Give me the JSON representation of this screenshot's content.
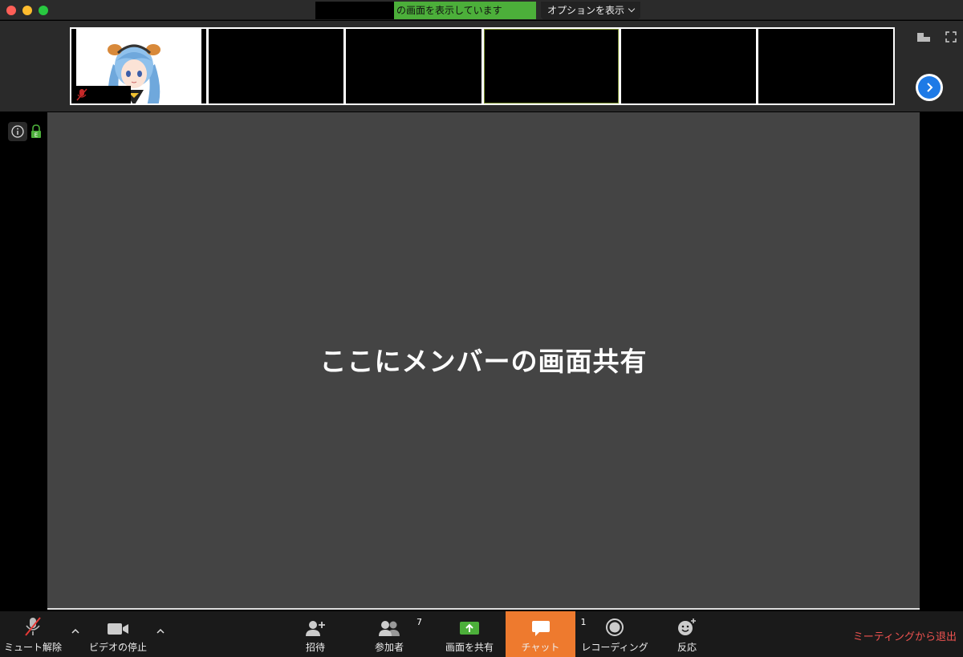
{
  "window": {
    "share_status": "の画面を表示しています",
    "options_label": "オプションを表示",
    "colors": {
      "share_green": "#4caf3a",
      "main_bg": "#444444",
      "chat_orange": "#ee7a2e",
      "end_red": "#ef5350",
      "nav_blue": "#1e7ae6"
    }
  },
  "filmstrip": {
    "thumbnails": [
      {
        "id": "participant-1",
        "muted": true
      },
      {
        "id": "participant-2"
      },
      {
        "id": "participant-3"
      },
      {
        "id": "participant-4",
        "highlighted": true
      },
      {
        "id": "participant-5"
      },
      {
        "id": "participant-6"
      }
    ],
    "icons": [
      "layout-icon",
      "fullscreen-icon",
      "next-page-icon"
    ]
  },
  "main": {
    "share_text": "ここにメンバーの画面共有"
  },
  "toolbar": {
    "unmute_label": "ミュート解除",
    "video_stop_label": "ビデオの停止",
    "invite_label": "招待",
    "participants_label": "参加者",
    "participants_count": "7",
    "share_screen_label": "画面を共有",
    "chat_label": "チャット",
    "chat_count": "1",
    "recording_label": "レコーディング",
    "reactions_label": "反応",
    "end_label": "ミーティングから退出"
  }
}
